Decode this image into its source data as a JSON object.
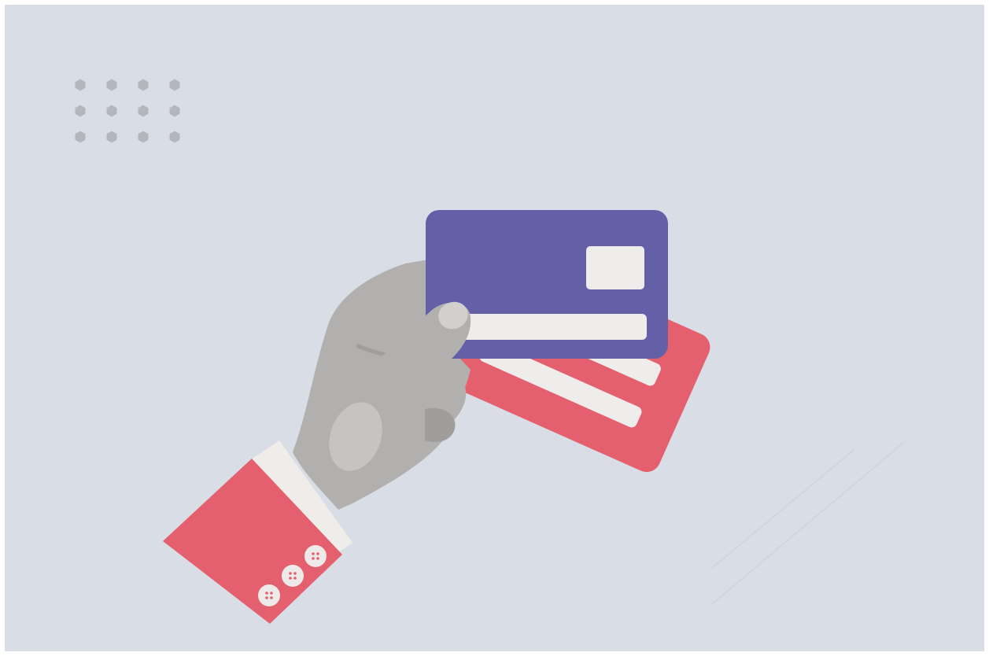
{
  "illustration": {
    "subject": "hand-holding-credit-cards",
    "colors": {
      "background": "#d9dee6",
      "frame": "#ffffff",
      "dots": "#b3b7bd",
      "card_front": "#6360a7",
      "card_back": "#e5606e",
      "card_stripe": "#efecec",
      "card_chip": "#efecec",
      "hand": "#b2b0ae",
      "hand_shadow": "#a09e9c",
      "hand_highlight": "#c6c4c2",
      "thumbnail": "#d2d0ce",
      "sleeve": "#e5606e",
      "cuff": "#efece9",
      "button": "#eeeaea",
      "button_hole": "#e5606e",
      "deco_lines": "#cfd4dc"
    }
  }
}
